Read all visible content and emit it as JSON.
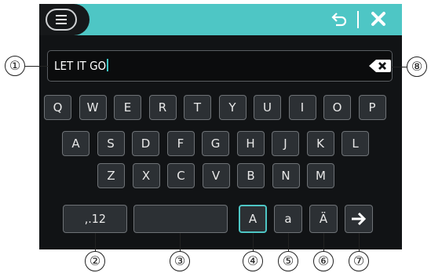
{
  "header": {
    "menu_icon": "hamburger-menu-icon",
    "undo_icon": "undo-arrow-icon",
    "close_icon": "close-x-icon"
  },
  "input": {
    "value": "LET IT GO",
    "backspace_icon": "backspace-icon"
  },
  "keyboard": {
    "row1": [
      "Q",
      "W",
      "E",
      "R",
      "T",
      "Y",
      "U",
      "I",
      "O",
      "P"
    ],
    "row2": [
      "A",
      "S",
      "D",
      "F",
      "G",
      "H",
      "J",
      "K",
      "L"
    ],
    "row3": [
      "Z",
      "X",
      "C",
      "V",
      "B",
      "N",
      "M"
    ],
    "bottom": {
      "symbols_label": ",.12",
      "space_label": "",
      "upper_label": "A",
      "lower_label": "a",
      "accent_label": "Ä",
      "enter_icon": "right-arrow-icon"
    }
  },
  "callouts": [
    "①",
    "②",
    "③",
    "④",
    "⑤",
    "⑥",
    "⑦",
    "⑧"
  ],
  "colors": {
    "accent": "#4ec6c5",
    "background": "#111315",
    "key": "#2c3034"
  }
}
